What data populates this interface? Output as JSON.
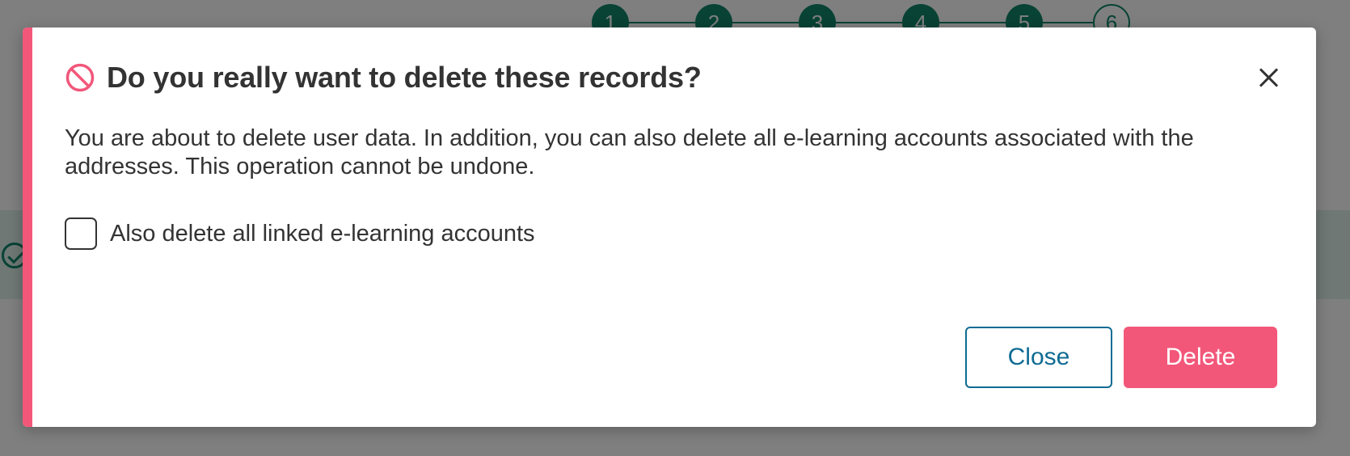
{
  "background": {
    "stepper": {
      "steps": [
        "1",
        "2",
        "3",
        "4",
        "5",
        "6"
      ],
      "current_step": "6"
    }
  },
  "dialog": {
    "title": "Do you really want to delete these records?",
    "message": "You are about to delete user data. In addition, you can also delete all e-learning accounts associated with the addresses. This operation cannot be undone.",
    "checkbox": {
      "label": "Also delete all linked e-learning accounts",
      "checked": false
    },
    "buttons": {
      "close_label": "Close",
      "delete_label": "Delete"
    },
    "icons": {
      "title_icon": "ban-icon",
      "dismiss_icon": "close-icon"
    },
    "colors": {
      "accent": "#f2577a",
      "secondary_button": "#0f6b93",
      "stepper": "#11876a"
    }
  }
}
